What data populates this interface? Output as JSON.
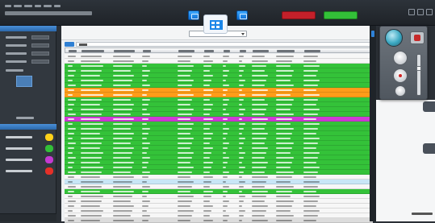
{
  "window": {
    "menu_items": [
      "",
      "",
      "",
      "",
      "",
      ""
    ],
    "title": ""
  },
  "toolbar": {
    "status_red_label": "",
    "status_green_label": "",
    "colors": {
      "accent": "#1b86e8",
      "status_red": "#c4202a",
      "status_green": "#33c038"
    },
    "icons": [
      "window-icon",
      "grid-view-icon",
      "window-icon"
    ]
  },
  "left_panel": {
    "header": "",
    "properties": [
      {
        "label": "",
        "value": ""
      },
      {
        "label": "",
        "value": ""
      },
      {
        "label": "",
        "value": ""
      },
      {
        "label": "",
        "value": ""
      }
    ],
    "section_label": "",
    "mid_header": "",
    "legend_header": "",
    "legend": [
      {
        "label": "",
        "color": "#ffd11a"
      },
      {
        "label": "",
        "color": "#33c038"
      },
      {
        "label": "",
        "color": "#c43ad1"
      },
      {
        "label": "",
        "color": "#e53028"
      }
    ],
    "footer": ""
  },
  "main": {
    "filter_value": "",
    "search_tag": "",
    "search_value": "",
    "columns": [
      "",
      "",
      "",
      "",
      "",
      "",
      "",
      "",
      "",
      "",
      ""
    ],
    "row_colors": {
      "green": "#34c239",
      "white": "#f7f7f7",
      "orange": "#ff9c19",
      "magenta": "#cf3ad5",
      "lightblue": "#c8e6f6",
      "grey": "#dcdcdc"
    },
    "rows": [
      {
        "status": "white"
      },
      {
        "status": "white"
      },
      {
        "status": "green"
      },
      {
        "status": "green"
      },
      {
        "status": "green"
      },
      {
        "status": "green"
      },
      {
        "status": "green"
      },
      {
        "status": "orange"
      },
      {
        "status": "orange"
      },
      {
        "status": "green"
      },
      {
        "status": "green"
      },
      {
        "status": "green"
      },
      {
        "status": "green"
      },
      {
        "status": "magenta"
      },
      {
        "status": "green"
      },
      {
        "status": "green"
      },
      {
        "status": "green"
      },
      {
        "status": "green"
      },
      {
        "status": "green"
      },
      {
        "status": "green"
      },
      {
        "status": "green"
      },
      {
        "status": "green"
      },
      {
        "status": "green"
      },
      {
        "status": "green"
      },
      {
        "status": "green"
      },
      {
        "status": "white"
      },
      {
        "status": "lightblue"
      },
      {
        "status": "white"
      },
      {
        "status": "green"
      },
      {
        "status": "white"
      },
      {
        "status": "white"
      },
      {
        "status": "white"
      },
      {
        "status": "white"
      },
      {
        "status": "white"
      },
      {
        "status": "grey"
      }
    ]
  },
  "control_panel": {
    "icons": [
      "dial-icon",
      "record-icon",
      "circle-button-icon",
      "circle-button-icon",
      "circle-button-icon",
      "slider-icon"
    ]
  },
  "footer_text": ""
}
